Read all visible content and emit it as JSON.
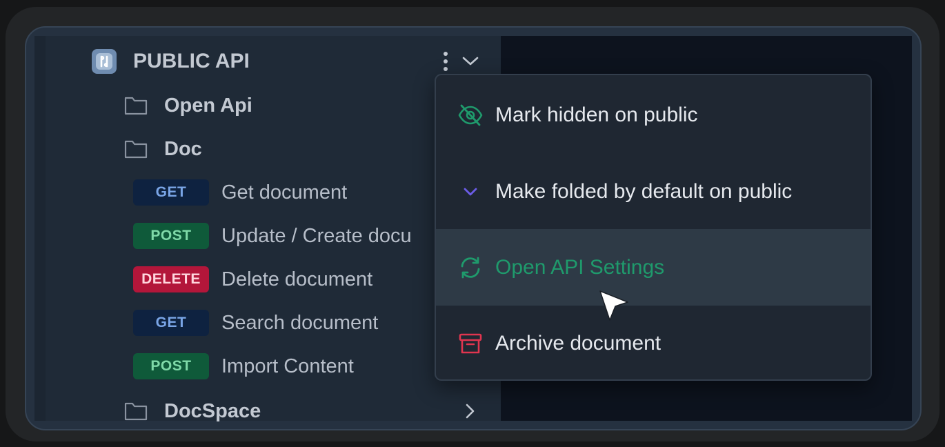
{
  "project": {
    "name": "PUBLIC API",
    "more_icon": "vertical-dots-icon",
    "collapse_icon": "chevron-down-icon"
  },
  "tree": {
    "folders": [
      {
        "label": "Open Api"
      },
      {
        "label": "Doc"
      },
      {
        "label": "DocSpace"
      }
    ],
    "endpoints": [
      {
        "method": "GET",
        "label": "Get document"
      },
      {
        "method": "POST",
        "label": "Update / Create docu"
      },
      {
        "method": "DELETE",
        "label": "Delete document"
      },
      {
        "method": "GET",
        "label": "Search document"
      },
      {
        "method": "POST",
        "label": "Import Content"
      }
    ]
  },
  "context_menu": {
    "items": [
      {
        "label": "Mark hidden on public",
        "icon": "eye-off-icon",
        "color": "#1f9a6c"
      },
      {
        "label": "Make folded by default on public",
        "icon": "chevron-down-icon",
        "color": "#6b5ce7"
      },
      {
        "label": "Open API Settings",
        "icon": "sync-icon",
        "color": "#1f9a6c"
      },
      {
        "label": "Archive document",
        "icon": "archive-icon",
        "color": "#e0354f"
      }
    ]
  },
  "colors": {
    "accent_green": "#1f9a6c",
    "get": "#7aa5e6",
    "post": "#7fd9a8",
    "delete": "#b3163a"
  }
}
